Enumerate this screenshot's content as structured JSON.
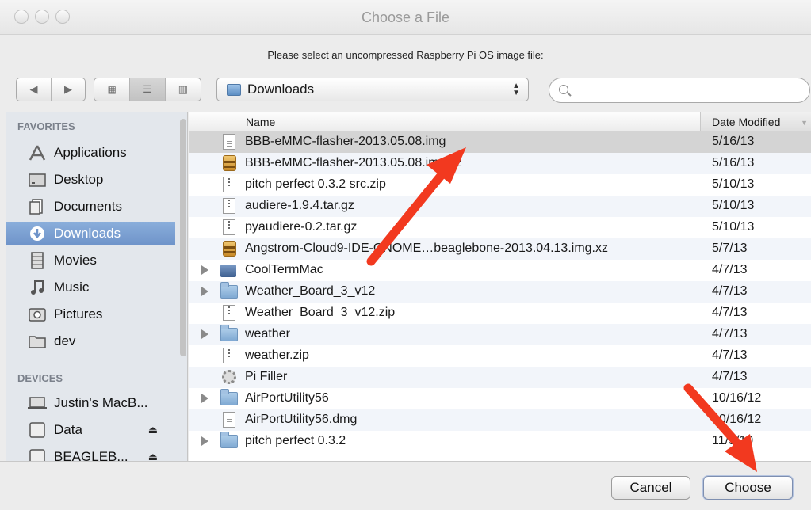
{
  "window": {
    "title": "Choose a File"
  },
  "prompt": "Please select an uncompressed Raspberry Pi OS image file:",
  "toolbar": {
    "nav": {
      "back_icon": "triangle-left-icon",
      "forward_icon": "triangle-right-icon"
    },
    "view_modes": [
      "icon-view",
      "list-view",
      "column-view"
    ],
    "active_view": "list-view",
    "location": "Downloads",
    "search": {
      "value": "",
      "placeholder": ""
    }
  },
  "sidebar": {
    "favorites_header": "FAVORITES",
    "favorites": [
      {
        "label": "Applications",
        "icon": "applications-icon"
      },
      {
        "label": "Desktop",
        "icon": "desktop-icon"
      },
      {
        "label": "Documents",
        "icon": "documents-icon"
      },
      {
        "label": "Downloads",
        "icon": "downloads-icon",
        "selected": true
      },
      {
        "label": "Movies",
        "icon": "movies-icon"
      },
      {
        "label": "Music",
        "icon": "music-icon"
      },
      {
        "label": "Pictures",
        "icon": "pictures-icon"
      },
      {
        "label": "dev",
        "icon": "folder-icon"
      }
    ],
    "devices_header": "DEVICES",
    "devices": [
      {
        "label": "Justin's MacB...",
        "icon": "laptop-icon"
      },
      {
        "label": "Data",
        "icon": "drive-icon",
        "eject": true
      },
      {
        "label": "BEAGLEB...",
        "icon": "drive-icon",
        "eject": true
      }
    ]
  },
  "columns": {
    "name": "Name",
    "date": "Date Modified"
  },
  "files": [
    {
      "name": "BBB-eMMC-flasher-2013.05.08.img",
      "date": "5/16/13",
      "kind": "doc",
      "selected": true
    },
    {
      "name": "BBB-eMMC-flasher-2013.05.08.img.xz",
      "date": "5/16/13",
      "kind": "xz"
    },
    {
      "name": "pitch perfect 0.3.2 src.zip",
      "date": "5/10/13",
      "kind": "zip"
    },
    {
      "name": "audiere-1.9.4.tar.gz",
      "date": "5/10/13",
      "kind": "zip"
    },
    {
      "name": "pyaudiere-0.2.tar.gz",
      "date": "5/10/13",
      "kind": "zip"
    },
    {
      "name": "Angstrom-Cloud9-IDE-GNOME…beaglebone-2013.04.13.img.xz",
      "date": "5/7/13",
      "kind": "xz"
    },
    {
      "name": "CoolTermMac",
      "date": "4/7/13",
      "kind": "app",
      "expandable": true
    },
    {
      "name": "Weather_Board_3_v12",
      "date": "4/7/13",
      "kind": "folder",
      "expandable": true
    },
    {
      "name": "Weather_Board_3_v12.zip",
      "date": "4/7/13",
      "kind": "zip"
    },
    {
      "name": "weather",
      "date": "4/7/13",
      "kind": "folder",
      "expandable": true
    },
    {
      "name": "weather.zip",
      "date": "4/7/13",
      "kind": "zip"
    },
    {
      "name": "Pi Filler",
      "date": "4/7/13",
      "kind": "gear"
    },
    {
      "name": "AirPortUtility56",
      "date": "10/16/12",
      "kind": "folder",
      "expandable": true
    },
    {
      "name": "AirPortUtility56.dmg",
      "date": "10/16/12",
      "kind": "doc"
    },
    {
      "name": "pitch perfect 0.3.2",
      "date": "11/5/10",
      "kind": "folder",
      "expandable": true
    }
  ],
  "buttons": {
    "cancel": "Cancel",
    "choose": "Choose"
  },
  "colors": {
    "selection": "#6e93c9",
    "annotation_arrow": "#f2391f"
  }
}
